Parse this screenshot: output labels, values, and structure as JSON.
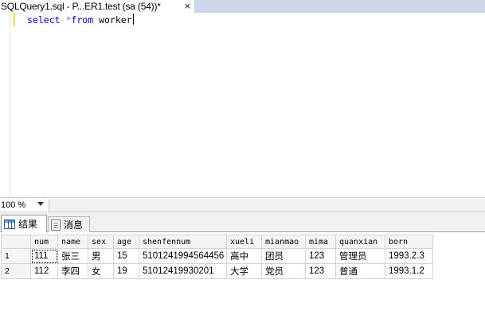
{
  "document_tab": {
    "title": "SQLQuery1.sql - P...ER1.test (sa (54))*",
    "close_glyph": "×"
  },
  "editor": {
    "keyword_select": "select",
    "operator_star": "*",
    "keyword_from": "from",
    "table_name": "worker"
  },
  "zoom": {
    "value": "100 %"
  },
  "result_tabs": {
    "results_label": "结果",
    "messages_label": "消息"
  },
  "results_grid": {
    "columns": [
      "num",
      "name",
      "sex",
      "age",
      "shenfennum",
      "xueli",
      "mianmao",
      "mima",
      "quanxian",
      "born"
    ],
    "rows": [
      {
        "row_number": "1",
        "cells": [
          "111",
          "张三",
          "男",
          "15",
          "5101241994564456",
          "高中",
          "团员",
          "123",
          "管理员",
          "1993.2.3"
        ]
      },
      {
        "row_number": "2",
        "cells": [
          "112",
          "李四",
          "女",
          "19",
          "51012419930201",
          "大学",
          "党员",
          "123",
          "普通",
          "1993.1.2"
        ]
      }
    ]
  },
  "colors": {
    "sql_keyword": "#0000ff",
    "sql_operator": "#808080",
    "change_marker": "#f3e86b",
    "tabstrip_bg": "#ced7e8"
  }
}
